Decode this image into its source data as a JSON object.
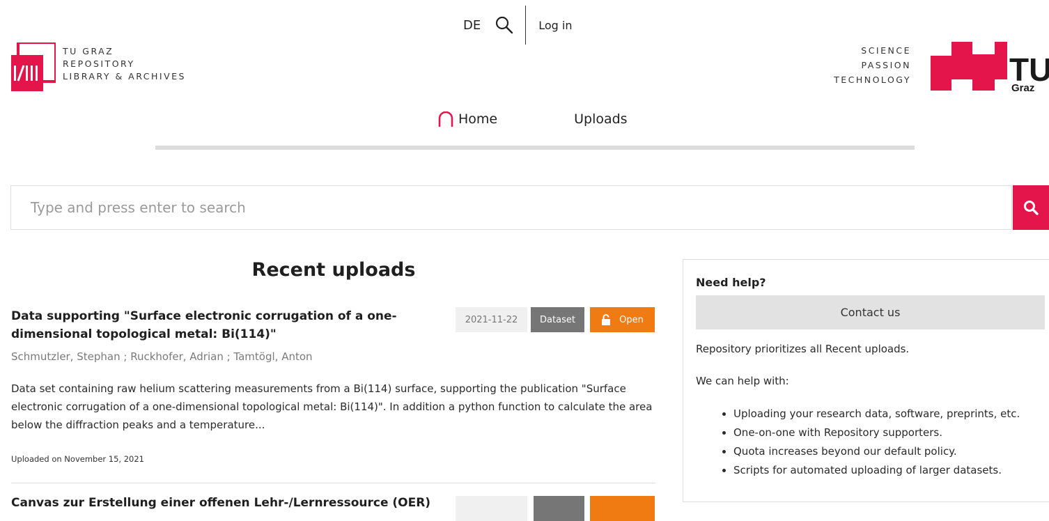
{
  "header": {
    "lang": "DE",
    "login": "Log in",
    "repo_logo_lines": [
      "TU GRAZ",
      "REPOSITORY",
      "LIBRARY & ARCHIVES"
    ],
    "tu_slogan": [
      "SCIENCE",
      "PASSION",
      "TECHNOLOGY"
    ],
    "tu_logo_text": "TU",
    "tu_logo_sub": "Graz"
  },
  "nav": {
    "home": "Home",
    "uploads": "Uploads"
  },
  "search": {
    "placeholder": "Type and press enter to search"
  },
  "recent": {
    "heading": "Recent uploads",
    "items": [
      {
        "title": "Data supporting \"Surface electronic corrugation of a one-dimensional topological metal: Bi(114)\"",
        "date": "2021-11-22",
        "type": "Dataset",
        "access": "Open",
        "authors": "Schmutzler, Stephan ; Ruckhofer, Adrian ; Tamtögl, Anton",
        "description": "Data set containing raw helium scattering measurements from a Bi(114) surface, supporting the publication \"Surface electronic corrugation of a one-dimensional topological metal: Bi(114)\". In addition a python function to calculate the area below the diffraction peaks and a temperature...",
        "uploaded": "Uploaded on November 15, 2021"
      },
      {
        "title": "Canvas zur Erstellung einer offenen Lehr-/Lernressource (OER)"
      }
    ]
  },
  "help": {
    "title": "Need help?",
    "contact": "Contact us",
    "text1": "Repository prioritizes all Recent uploads.",
    "text2": "We can help with:",
    "list": [
      "Uploading your research data, software, preprints, etc.",
      "One-on-one with Repository supporters.",
      "Quota increases beyond our default policy.",
      "Scripts for automated uploading of larger datasets."
    ]
  },
  "colors": {
    "brand_red": "#e4154b",
    "open_orange": "#f07b12",
    "dataset_gray": "#767676"
  }
}
